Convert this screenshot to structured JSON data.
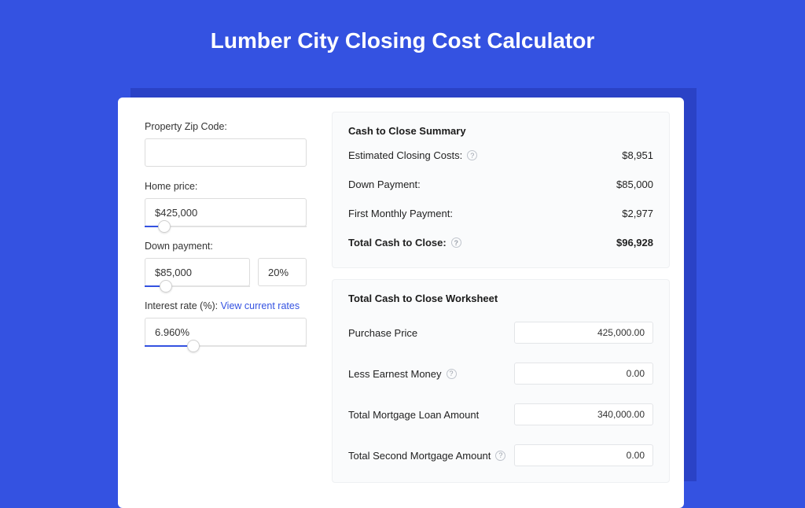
{
  "title": "Lumber City Closing Cost Calculator",
  "left": {
    "zip_label": "Property Zip Code:",
    "zip_value": "",
    "home_price_label": "Home price:",
    "home_price_value": "$425,000",
    "home_price_pct": 12,
    "down_payment_label": "Down payment:",
    "down_payment_value": "$85,000",
    "down_payment_pct_value": "20%",
    "down_payment_slider_pct": 20,
    "rate_label_prefix": "Interest rate (%): ",
    "rate_link": "View current rates",
    "rate_value": "6.960%",
    "rate_slider_pct": 30
  },
  "summary": {
    "title": "Cash to Close Summary",
    "rows": [
      {
        "label": "Estimated Closing Costs:",
        "help": true,
        "value": "$8,951",
        "bold": false
      },
      {
        "label": "Down Payment:",
        "help": false,
        "value": "$85,000",
        "bold": false
      },
      {
        "label": "First Monthly Payment:",
        "help": false,
        "value": "$2,977",
        "bold": false
      },
      {
        "label": "Total Cash to Close:",
        "help": true,
        "value": "$96,928",
        "bold": true
      }
    ]
  },
  "worksheet": {
    "title": "Total Cash to Close Worksheet",
    "rows": [
      {
        "label": "Purchase Price",
        "help": false,
        "value": "425,000.00"
      },
      {
        "label": "Less Earnest Money",
        "help": true,
        "value": "0.00"
      },
      {
        "label": "Total Mortgage Loan Amount",
        "help": false,
        "value": "340,000.00"
      },
      {
        "label": "Total Second Mortgage Amount",
        "help": true,
        "value": "0.00"
      }
    ]
  }
}
